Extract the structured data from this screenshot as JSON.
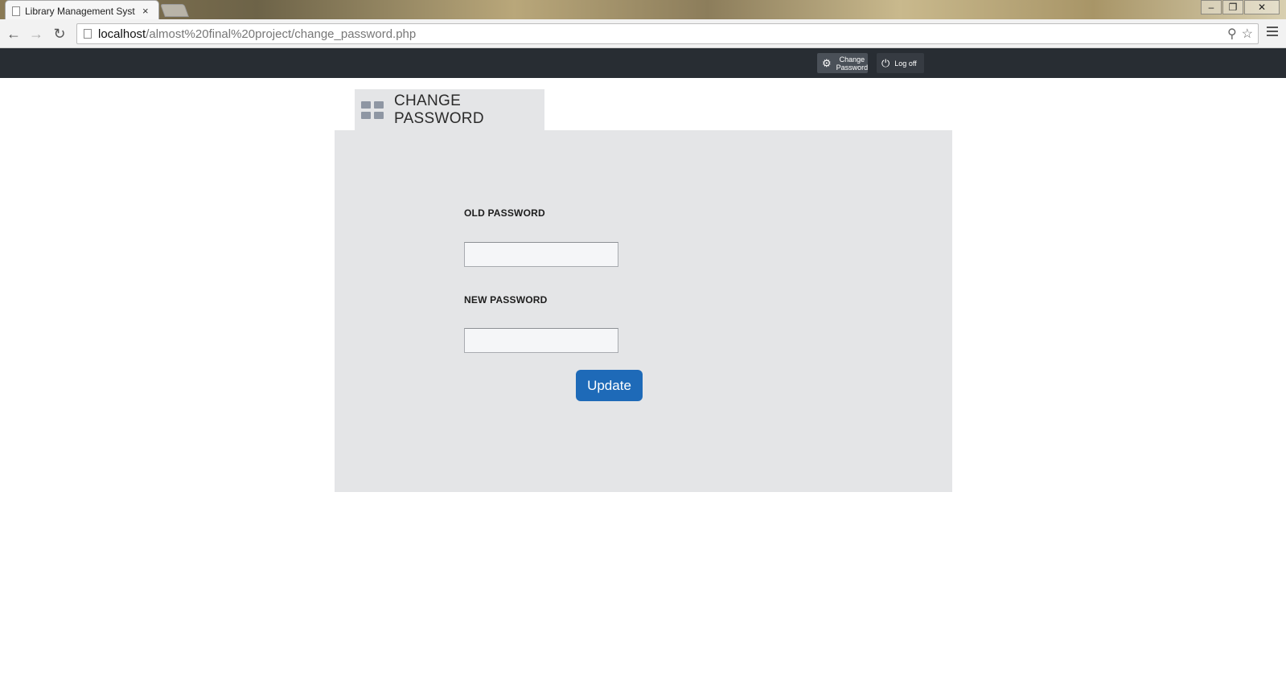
{
  "browser": {
    "tab_title": "Library Management Syst",
    "tab_close": "×",
    "window_controls": {
      "minimize": "–",
      "maximize": "❐",
      "close": "✕"
    },
    "nav": {
      "back": "←",
      "forward": "→",
      "reload": "↻"
    },
    "url_host": "localhost",
    "url_path": "/almost%20final%20project/change_password.php",
    "omni_icons": {
      "zoom": "⚲",
      "bookmark": "☆"
    }
  },
  "header": {
    "change_password_line1": "Change",
    "change_password_line2": "Password",
    "change_password_icon": "gear-icon",
    "log_off_label": "Log off",
    "log_off_icon": "power-icon"
  },
  "panel": {
    "title": "CHANGE PASSWORD",
    "title_icon": "dashboard-grid-icon",
    "old_password_label": "OLD PASSWORD",
    "old_password_value": "",
    "new_password_label": "NEW PASSWORD",
    "new_password_value": "",
    "update_label": "Update"
  },
  "colors": {
    "header_bg": "#282d33",
    "panel_bg": "#e4e5e7",
    "button_blue": "#1e6ab8"
  }
}
